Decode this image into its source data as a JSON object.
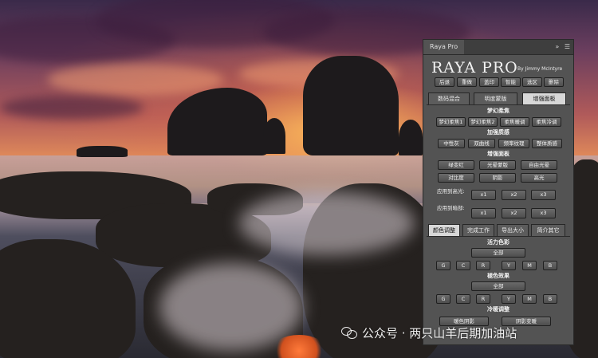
{
  "panel": {
    "tab_title": "Raya Pro",
    "menu_icons": [
      "double-chevron-icon",
      "menu-icon"
    ],
    "logo": "RAYA PRO",
    "byline": "By Jimmy McIntyre",
    "top_buttons": [
      "后退",
      "重做",
      "盖印",
      "智能",
      "选区",
      "删除"
    ],
    "tabs": [
      "数码混合",
      "明度蒙版",
      "增强面板"
    ],
    "active_tab": "增强面板",
    "sections": {
      "dreamy_soft": {
        "title": "梦幻柔焦",
        "buttons": [
          "梦幻柔焦1",
          "梦幻柔焦2",
          "柔焦暖调",
          "柔焦冷调"
        ]
      },
      "enhance_details": {
        "title": "加强质感",
        "buttons": [
          "中性灰",
          "双曲线",
          "频率纹理",
          "整体质感"
        ]
      },
      "enhance_panel": {
        "title": "增强面板",
        "buttons": [
          "绿变红",
          "光晕蒙版",
          "自由光晕",
          "对比度",
          "阴影",
          "高光"
        ],
        "apply_highlights_label": "应用到高光:",
        "apply_shadows_label": "应用到暗部:",
        "multipliers": [
          "x1",
          "x2",
          "x3"
        ]
      }
    },
    "bottom_tabs": [
      "颜色调整",
      "完成工作",
      "导出大小",
      "简介其它"
    ],
    "active_bottom_tab": "颜色调整",
    "color": {
      "vibrance_title": "活力色彩",
      "all_label": "全部",
      "channels": [
        "G",
        "C",
        "R",
        "Y",
        "M",
        "B"
      ],
      "color_effect_title": "褪色效果",
      "warm_cool_title": "冷暖调整",
      "warm_cool_buttons": [
        "暖色阴影",
        "阴影变暖"
      ]
    }
  },
  "watermark": {
    "text": "公众号 · 两只山羊后期加油站"
  }
}
